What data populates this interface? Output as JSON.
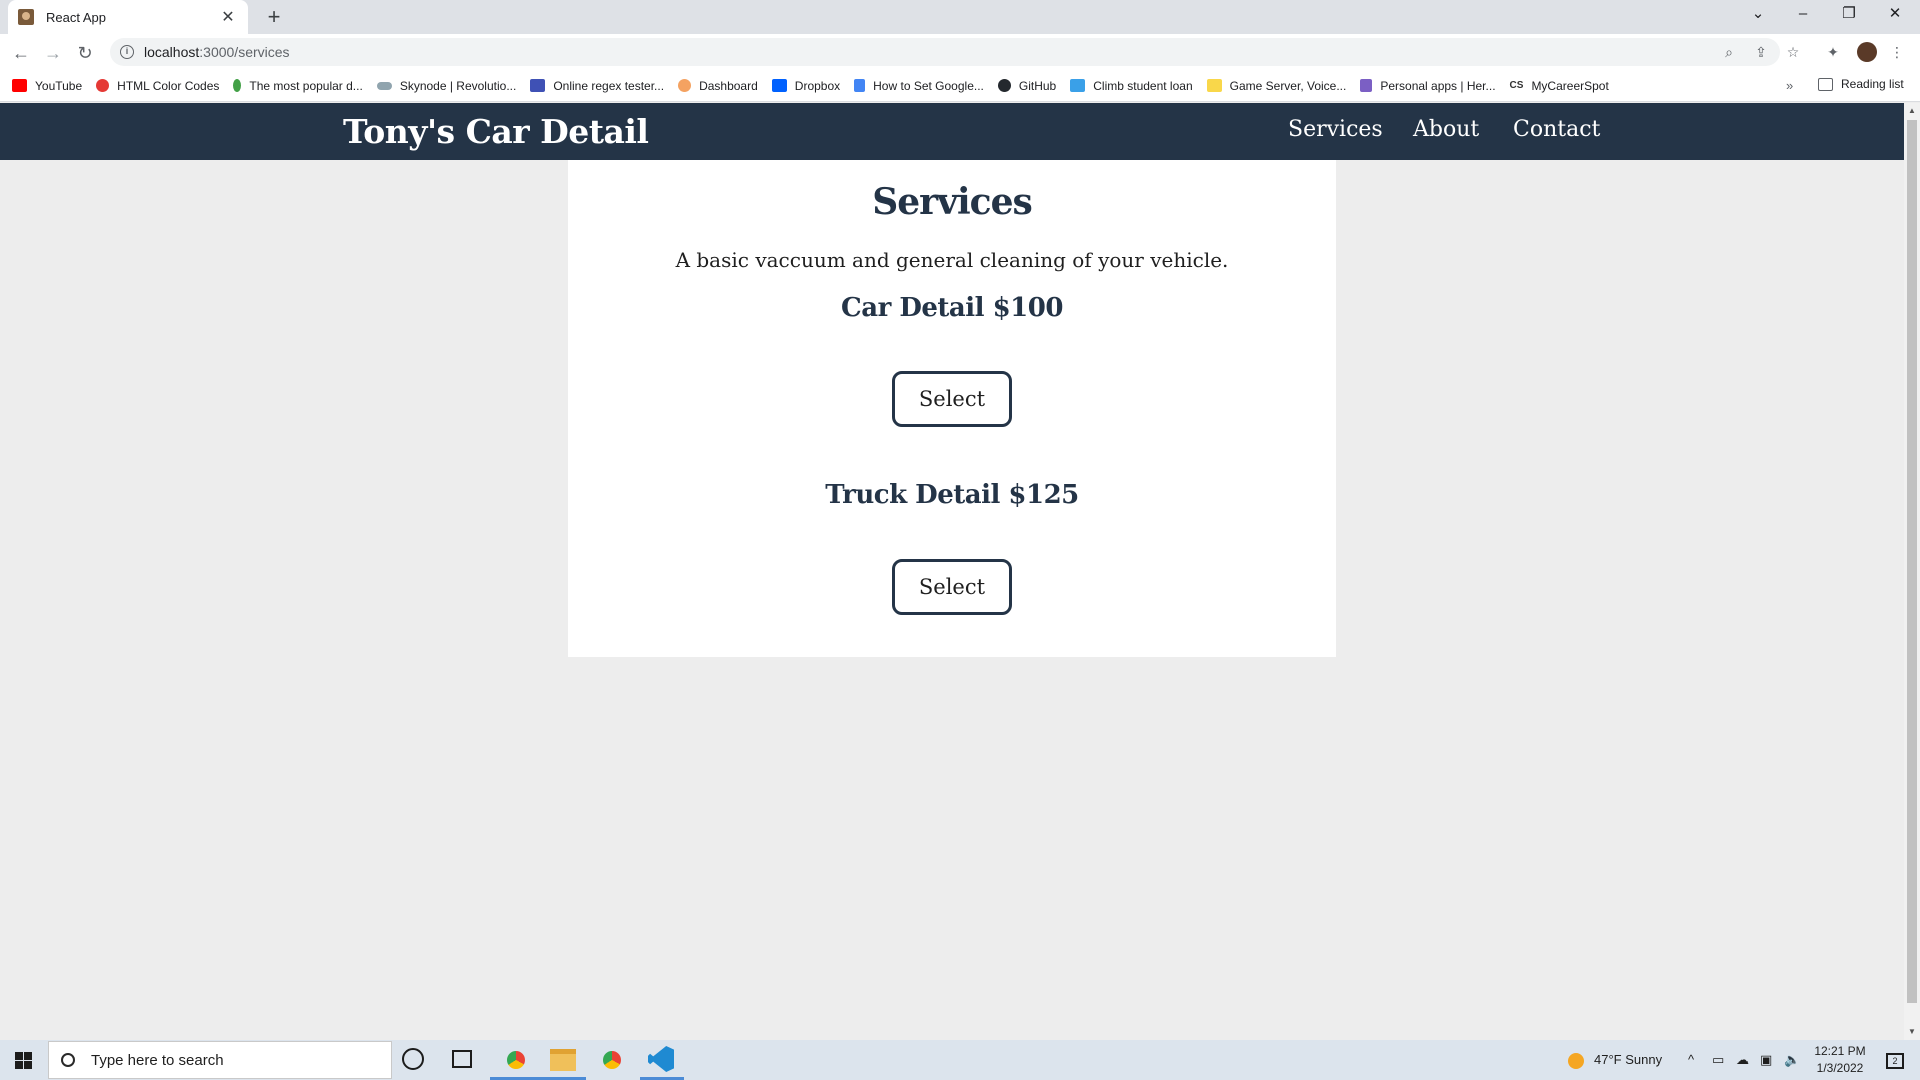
{
  "browser": {
    "tab_title": "React App",
    "url_host": "localhost",
    "url_path": ":3000/services",
    "bookmarks": [
      {
        "label": "YouTube",
        "icon": "youtube-icon",
        "color": "#ff0000"
      },
      {
        "label": "HTML Color Codes",
        "icon": "html-color-codes-icon",
        "color": "#e53935"
      },
      {
        "label": "The most popular d...",
        "icon": "leaf-icon",
        "color": "#43a047"
      },
      {
        "label": "Skynode | Revolutio...",
        "icon": "cloud-icon",
        "color": "#90a4ae"
      },
      {
        "label": "Online regex tester...",
        "icon": "regex-icon",
        "color": "#3f51b5"
      },
      {
        "label": "Dashboard",
        "icon": "dashboard-icon",
        "color": "#f4a261"
      },
      {
        "label": "Dropbox",
        "icon": "dropbox-icon",
        "color": "#0061fe"
      },
      {
        "label": "How to Set Google...",
        "icon": "google-docs-icon",
        "color": "#4285f4"
      },
      {
        "label": "GitHub",
        "icon": "github-icon",
        "color": "#24292e"
      },
      {
        "label": "Climb student loan",
        "icon": "square-icon",
        "color": "#3aa0e8"
      },
      {
        "label": "Game Server, Voice...",
        "icon": "square-icon",
        "color": "#f9d74a"
      },
      {
        "label": "Personal apps | Her...",
        "icon": "heroku-icon",
        "color": "#7b5fc4"
      },
      {
        "label": "MyCareerSpot",
        "icon": "cs-icon",
        "color": "#333333"
      }
    ],
    "more_bookmarks": "»",
    "reading_list": "Reading list"
  },
  "site": {
    "logo": "Tony's Car Detail",
    "nav": [
      "Services",
      "About",
      "Contact"
    ]
  },
  "services": {
    "title": "Services",
    "description": "A basic vaccuum and general cleaning of your vehicle.",
    "items": [
      {
        "name": "Car Detail $100",
        "button": "Select"
      },
      {
        "name": "Truck Detail $125",
        "button": "Select"
      }
    ]
  },
  "taskbar": {
    "search_placeholder": "Type here to search",
    "weather": "47°F  Sunny",
    "time": "12:21 PM",
    "date": "1/3/2022",
    "notification_count": "2"
  }
}
